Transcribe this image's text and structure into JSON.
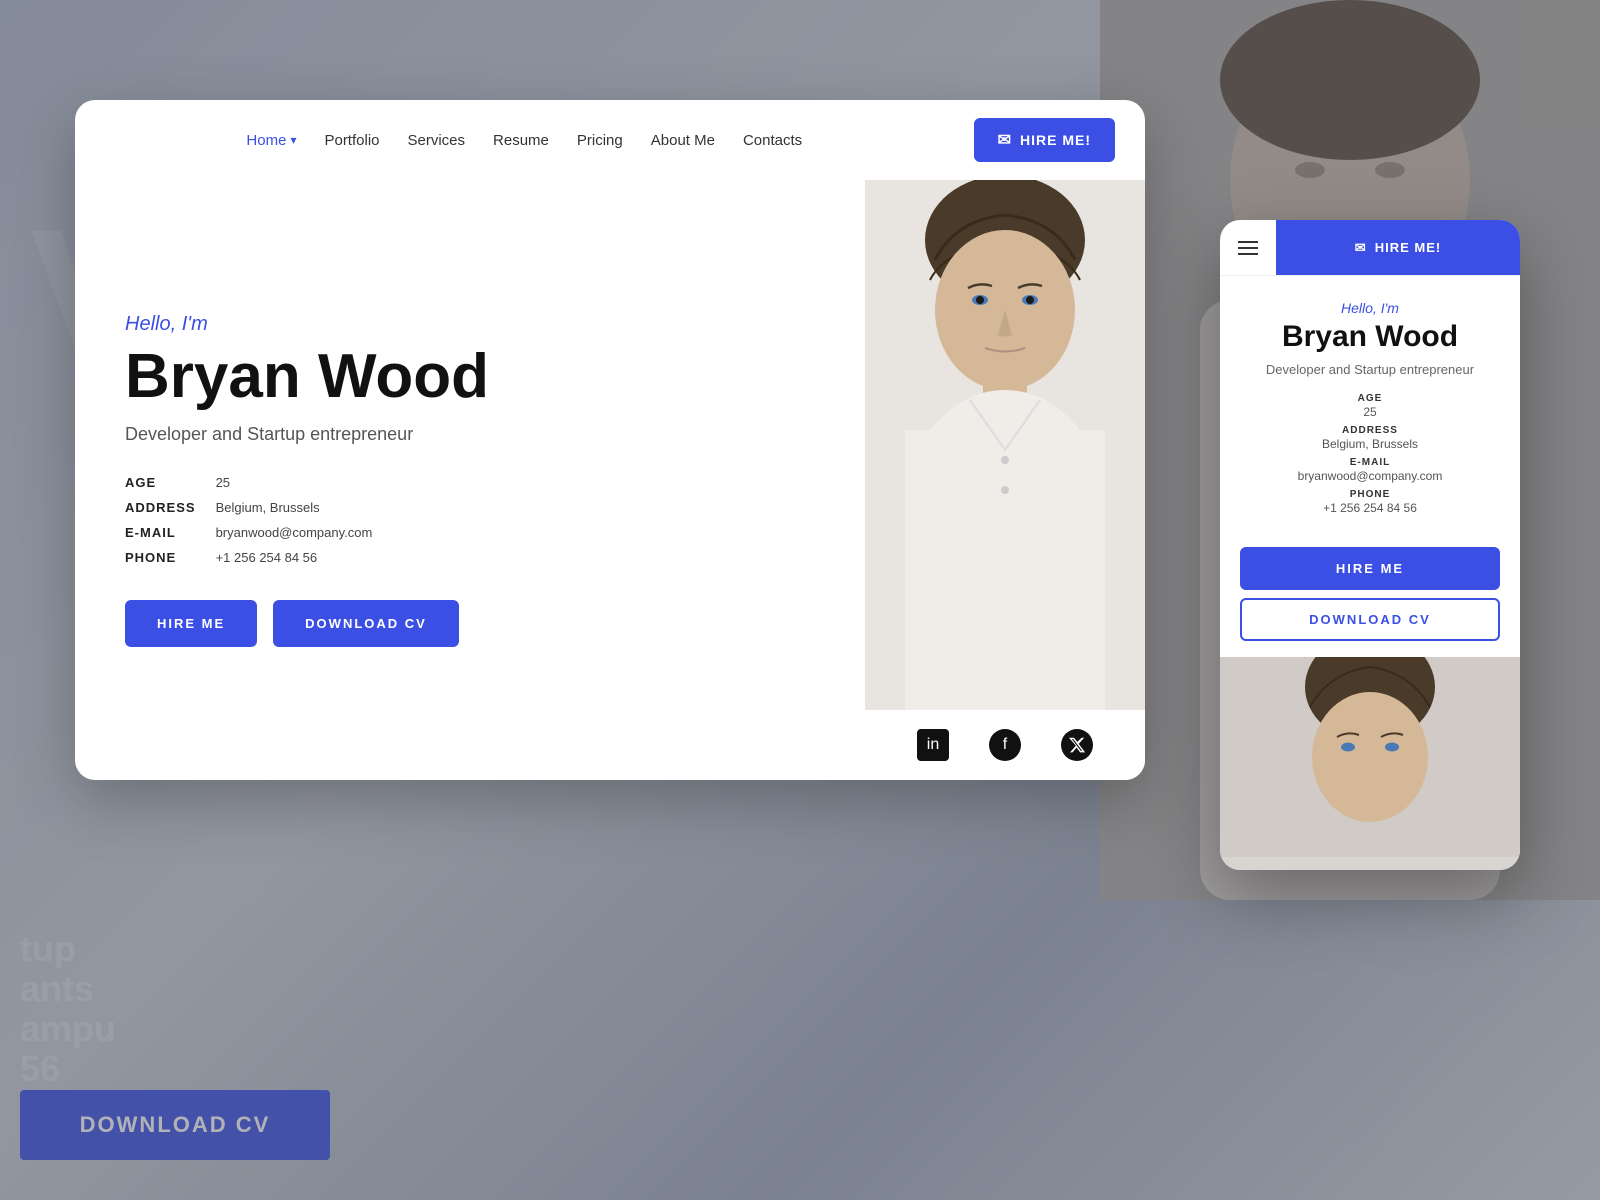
{
  "background": {
    "text_v": "V",
    "text_lines": [
      "tup",
      "ants",
      "ampu",
      "56"
    ],
    "download_cv_label": "DOWNLOAD CV"
  },
  "nav": {
    "home_label": "Home",
    "portfolio_label": "Portfolio",
    "services_label": "Services",
    "resume_label": "Resume",
    "pricing_label": "Pricing",
    "about_label": "About Me",
    "contacts_label": "Contacts",
    "hire_btn_label": "HIRE ME!"
  },
  "hero": {
    "hello_text": "Hello, I'm",
    "name": "Bryan Wood",
    "subtitle": "Developer and Startup entrepreneur",
    "age_label": "AGE",
    "age_value": "25",
    "address_label": "ADDRESS",
    "address_value": "Belgium, Brussels",
    "email_label": "E-MAIL",
    "email_value": "bryanwood@company.com",
    "phone_label": "PHONE",
    "phone_value": "+1 256 254 84 56",
    "hire_me_btn": "HIRE ME",
    "download_cv_btn": "DOWNLOAD CV"
  },
  "mobile": {
    "hello_text": "Hello, I'm",
    "name": "Bryan Wood",
    "subtitle": "Developer and Startup entrepreneur",
    "age_label": "AGE",
    "age_value": "25",
    "address_label": "ADDRESS",
    "address_value": "Belgium, Brussels",
    "email_label": "E-MAIL",
    "email_value": "bryanwood@company.com",
    "phone_label": "PHONE",
    "phone_value": "+1 256 254 84 56",
    "hire_me_btn": "HIRE ME",
    "download_cv_btn": "DOWNLOAD CV",
    "hire_nav_btn": "HIRE ME!"
  },
  "social": {
    "linkedin_icon": "in",
    "facebook_icon": "f",
    "twitter_icon": "𝕏"
  },
  "colors": {
    "accent": "#3b4fe4",
    "text_dark": "#111111",
    "text_mid": "#555555",
    "text_light": "#888888"
  }
}
